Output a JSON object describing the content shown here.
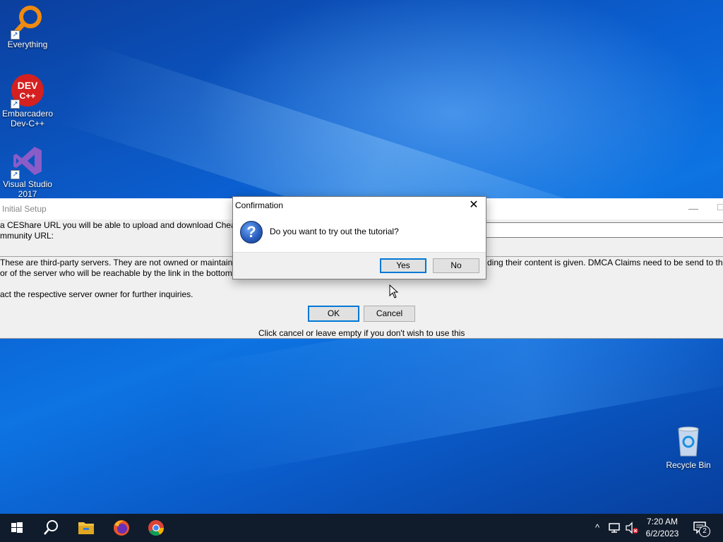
{
  "desktop": {
    "icons": [
      {
        "label": "Everything",
        "icon": "everything-search-icon"
      },
      {
        "label": "Embarcadero Dev-C++",
        "line1": "Embarcadero",
        "line2": "Dev-C++",
        "icon": "devcpp-icon",
        "icon_text": "DEV C++"
      },
      {
        "label": "Visual Studio 2017",
        "line1": "Visual Studio",
        "line2": "2017",
        "icon": "visual-studio-icon"
      },
      {
        "label": "Recycle Bin",
        "icon": "recycle-bin-icon"
      }
    ]
  },
  "setup_window": {
    "title": "Initial Setup",
    "line1": "a CEShare URL you will be able to upload and download Cheat",
    "line2": "mmunity URL:",
    "disclaimer1": "These are third-party servers. They are not owned or maintained",
    "disclaimer1_right": "ding their content is given.  DMCA Claims need to be send to the",
    "disclaimer2": "or of the server who will be reachable by the link in the bottom",
    "disclaimer3": "act the respective server owner for further inquiries.",
    "ok_label": "OK",
    "cancel_label": "Cancel",
    "hint": "Click cancel or leave empty if you don't wish to use this",
    "minimize_glyph": "—",
    "maximize_glyph": "□"
  },
  "dialog": {
    "title": "Confirmation",
    "close_glyph": "✕",
    "icon": "question-icon",
    "icon_glyph": "?",
    "message": "Do you want to try out the tutorial?",
    "yes_label": "Yes",
    "no_label": "No"
  },
  "taskbar": {
    "pinned": [
      {
        "name": "start",
        "icon": "windows-start-icon"
      },
      {
        "name": "search",
        "icon": "search-icon"
      },
      {
        "name": "file-explorer",
        "icon": "folder-icon"
      },
      {
        "name": "firefox",
        "icon": "firefox-icon"
      },
      {
        "name": "chrome",
        "icon": "chrome-icon"
      }
    ],
    "tray": {
      "chevron": "^",
      "time": "7:20 AM",
      "date": "6/2/2023",
      "notification_count": "2"
    }
  },
  "colors": {
    "accent": "#0078d7",
    "taskbar": "#101c2c",
    "desktop": "#0b5fd0"
  }
}
